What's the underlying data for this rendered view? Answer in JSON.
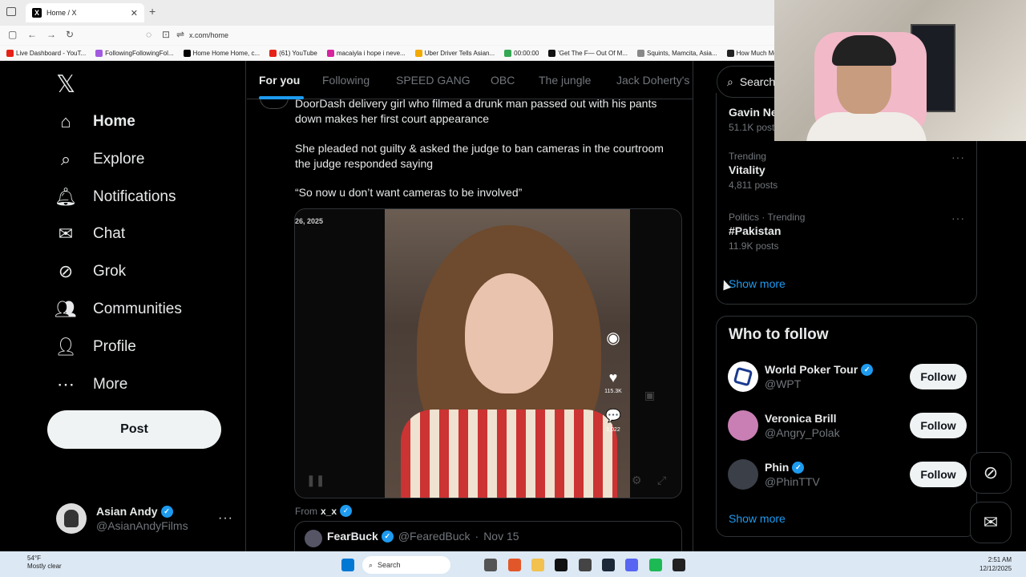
{
  "browser": {
    "tab_title": "Home / X",
    "url": "x.com/home",
    "bookmarks": [
      {
        "label": "Live Dashboard - YouT...",
        "color": "#e62117"
      },
      {
        "label": "FollowingFollowingFol...",
        "color": "#a25ae0"
      },
      {
        "label": "Home Home Home, c...",
        "color": "#000000"
      },
      {
        "label": "(61) YouTube",
        "color": "#e62117"
      },
      {
        "label": "macaiyla i hope i neve...",
        "color": "#d6249f"
      },
      {
        "label": "Uber Driver Tells Asian...",
        "color": "#f2a900"
      },
      {
        "label": "00:00:00",
        "color": "#34a853"
      },
      {
        "label": "'Get The F— Out Of M...",
        "color": "#111111"
      },
      {
        "label": "Squints, Mamcita, Asia...",
        "color": "#888888"
      },
      {
        "label": "How Much Mone",
        "color": "#222222"
      }
    ]
  },
  "nav": {
    "items": [
      {
        "label": "Home",
        "icon": "home-icon"
      },
      {
        "label": "Explore",
        "icon": "search-icon"
      },
      {
        "label": "Notifications",
        "icon": "bell-icon"
      },
      {
        "label": "Chat",
        "icon": "mail-icon"
      },
      {
        "label": "Grok",
        "icon": "grok-icon"
      },
      {
        "label": "Communities",
        "icon": "people-icon"
      },
      {
        "label": "Profile",
        "icon": "person-icon"
      },
      {
        "label": "More",
        "icon": "more-circle-icon"
      }
    ],
    "post_label": "Post",
    "account": {
      "name": "Asian Andy",
      "handle": "@AsianAndyFilms"
    }
  },
  "feed": {
    "tabs": [
      "For you",
      "Following",
      "SPEED GANG",
      "OBC",
      "The jungle",
      "Jack Doherty's"
    ],
    "active_tab": "For you",
    "tweet": {
      "line1": "DoorDash delivery girl who filmed a drunk man passed out with his pants down makes her first court appearance",
      "line2": "She pleaded not guilty & asked the judge to ban cameras in the courtroom the judge responded saying",
      "line3": "“So now u don’t want cameras to be involved”",
      "video_date": "26, 2025",
      "likes": "115.3K",
      "comments": "1,022",
      "from_label": "From",
      "from_account": "x_x"
    },
    "quote": {
      "name": "FearBuck",
      "handle": "@FearedBuck",
      "date": "Nov 15"
    }
  },
  "sidebar": {
    "search_placeholder": "Search",
    "trends": [
      {
        "category": "",
        "title": "Gavin Ne",
        "count": "51.1K posts"
      },
      {
        "category": "Trending",
        "title": "Vitality",
        "count": "4,811 posts"
      },
      {
        "category": "Politics · Trending",
        "title": "#Pakistan",
        "count": "11.9K posts"
      }
    ],
    "show_more": "Show more",
    "who_to_follow": {
      "title": "Who to follow",
      "accounts": [
        {
          "name": "World Poker Tour",
          "handle": "@WPT",
          "verified": true,
          "follow": "Follow"
        },
        {
          "name": "Veronica Brill",
          "handle": "@Angry_Polak",
          "verified": false,
          "follow": "Follow"
        },
        {
          "name": "Phin",
          "handle": "@PhinTTV",
          "verified": true,
          "follow": "Follow"
        }
      ],
      "show_more": "Show more"
    }
  },
  "taskbar": {
    "temp": "54°F",
    "weather": "Mostly clear",
    "search": "Search",
    "time": "2:51 AM",
    "date": "12/12/2025"
  }
}
